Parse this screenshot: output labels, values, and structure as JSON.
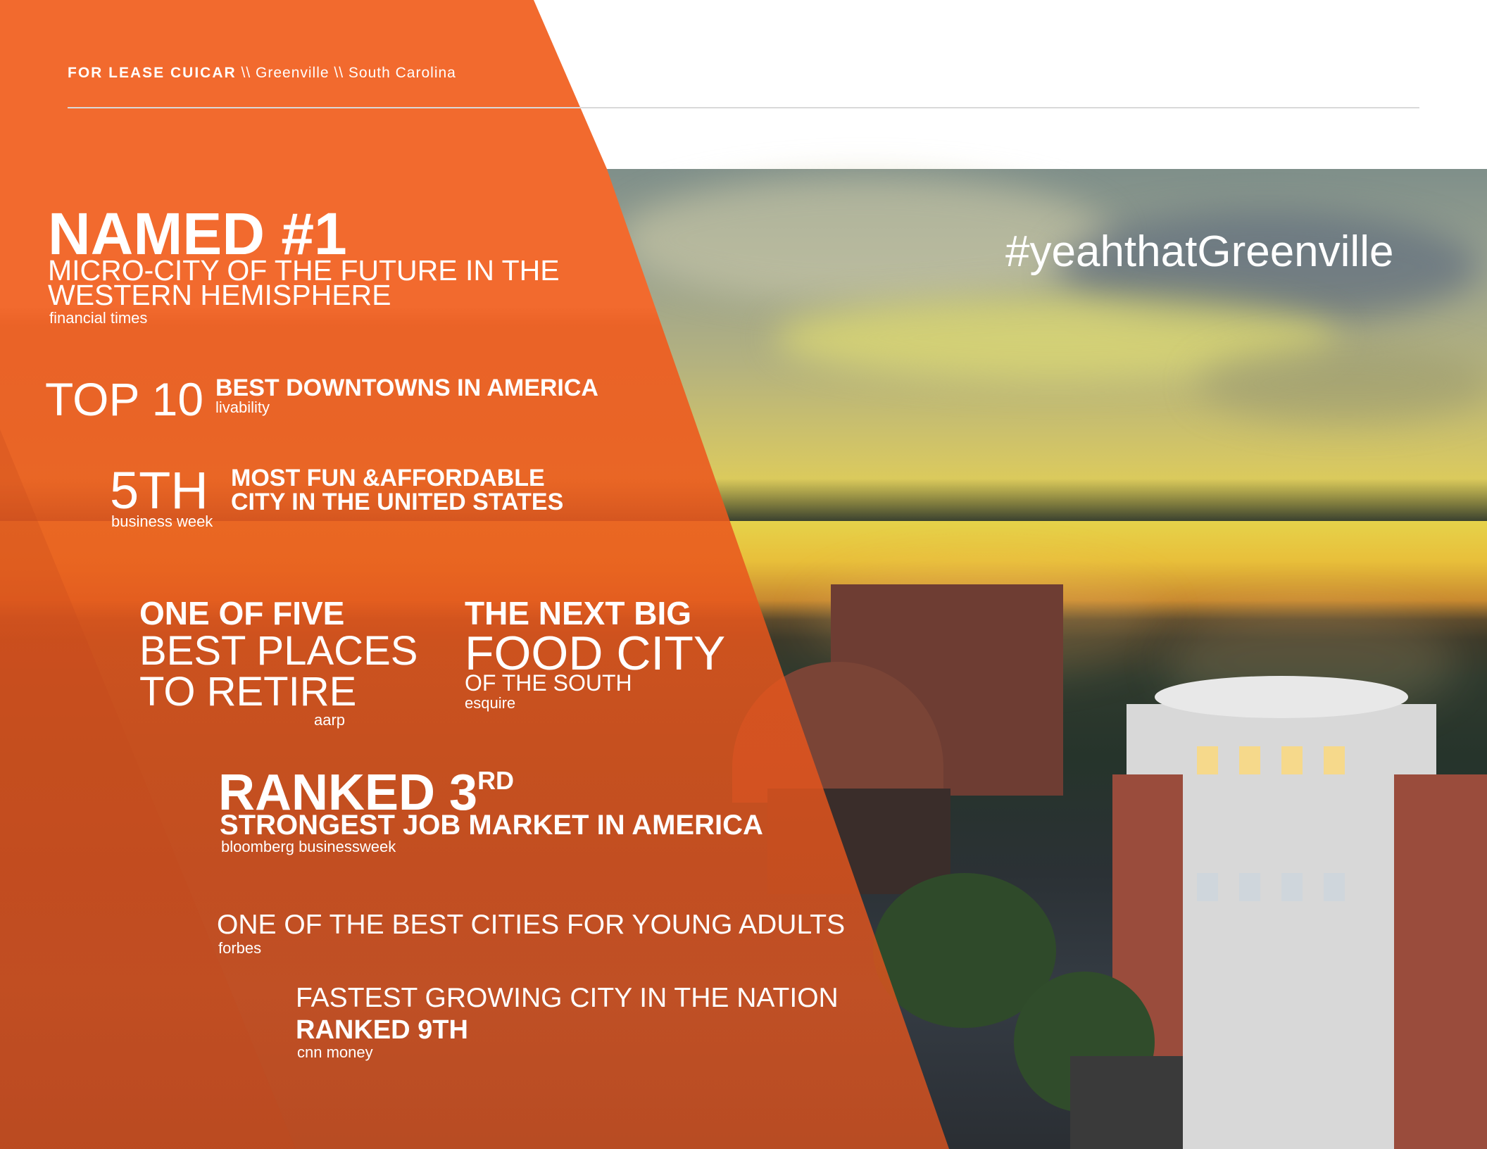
{
  "header": {
    "lead": "FOR LEASE CUICAR",
    "sep1": " \\\\ ",
    "city": "Greenville",
    "sep2": " \\\\ ",
    "state": "South Carolina"
  },
  "hashtag": "#yeahthatGreenville",
  "accolades": {
    "named": {
      "headline": "NAMED #1",
      "line1": "MICRO-CITY OF THE FUTURE IN THE",
      "line2": "WESTERN HEMISPHERE",
      "source": "financial times"
    },
    "top10": {
      "rank": "TOP 10",
      "title": "BEST DOWNTOWNS IN AMERICA",
      "source": "livability"
    },
    "fifth": {
      "rank": "5TH",
      "line1": "MOST FUN &AFFORDABLE",
      "line2": "CITY IN THE UNITED STATES",
      "source": "business week"
    },
    "retire": {
      "line1": "ONE OF FIVE",
      "line2": "BEST PLACES",
      "line3": "TO RETIRE",
      "source": "aarp"
    },
    "food": {
      "line1": "THE NEXT BIG",
      "line2": "FOOD CITY",
      "line3": "OF THE SOUTH",
      "source": "esquire"
    },
    "ranked3": {
      "headline": "RANKED 3",
      "suffix": "RD",
      "title": "STRONGEST JOB MARKET IN AMERICA",
      "source": "bloomberg businessweek"
    },
    "young": {
      "title": "ONE OF THE BEST CITIES FOR YOUNG ADULTS",
      "source": "forbes"
    },
    "fastest": {
      "title": "FASTEST GROWING CITY IN THE NATION",
      "rank": "RANKED 9TH",
      "source": "cnn money"
    }
  },
  "colors": {
    "orange": "#f26a2e",
    "white": "#ffffff",
    "rule": "#d9d9d9"
  }
}
